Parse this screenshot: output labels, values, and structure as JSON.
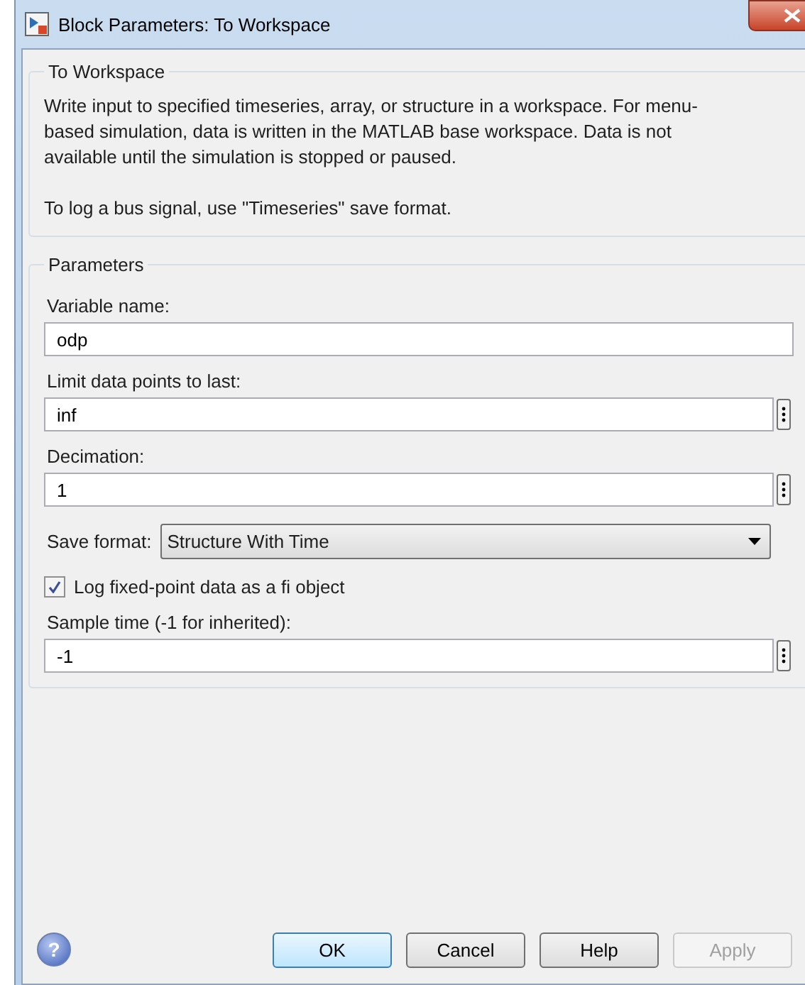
{
  "window": {
    "title": "Block Parameters: To Workspace"
  },
  "description": {
    "title": "To Workspace",
    "paragraphs": [
      "Write input to specified timeseries, array, or structure in a workspace. For menu-based simulation, data is written in the MATLAB base workspace. Data is not available until the simulation is stopped or paused.",
      "To log a bus signal, use \"Timeseries\" save format."
    ]
  },
  "parameters": {
    "title": "Parameters",
    "items": [
      {
        "kind": "text",
        "label": "Variable name:",
        "value": "odp"
      },
      {
        "kind": "text-more",
        "label": "Limit data points to last:",
        "value": "inf"
      },
      {
        "kind": "text-more",
        "label": "Decimation:",
        "value": "1"
      },
      {
        "kind": "select",
        "label": "Save format:",
        "value": "Structure With Time"
      },
      {
        "kind": "checkbox",
        "label": "Log fixed-point data as a fi object",
        "checked": true
      },
      {
        "kind": "text-more",
        "label": "Sample time (-1 for inherited):",
        "value": "-1"
      }
    ]
  },
  "help_icon": "?",
  "buttons": [
    {
      "label": "OK",
      "default": true,
      "disabled": false
    },
    {
      "label": "Cancel",
      "default": false,
      "disabled": false
    },
    {
      "label": "Help",
      "default": false,
      "disabled": false
    },
    {
      "label": "Apply",
      "default": false,
      "disabled": true
    }
  ]
}
